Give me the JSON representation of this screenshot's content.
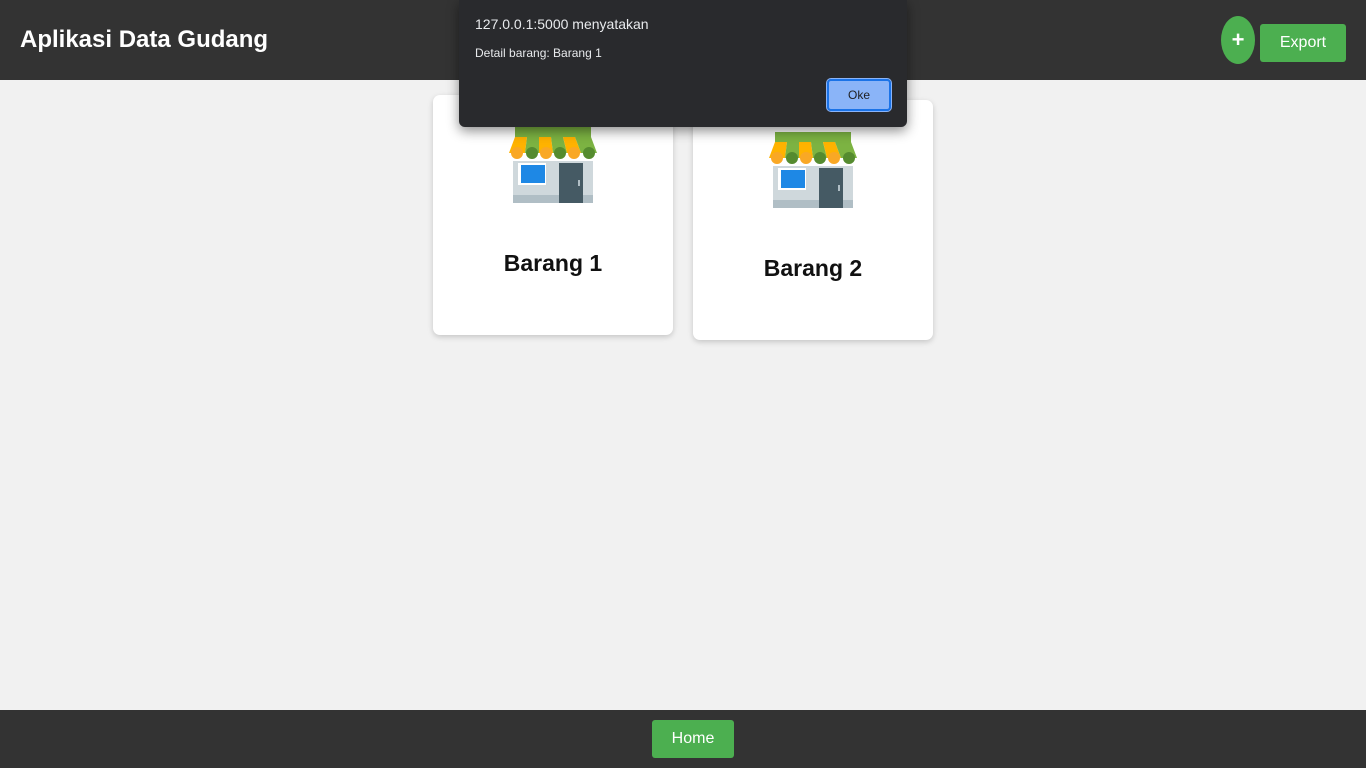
{
  "header": {
    "title": "Aplikasi Data Gudang",
    "add_label": "+",
    "export_label": "Export"
  },
  "cards": [
    {
      "title": "Barang 1",
      "icon": "store-icon"
    },
    {
      "title": "Barang 2",
      "icon": "store-icon"
    }
  ],
  "footer": {
    "home_label": "Home"
  },
  "dialog": {
    "origin": "127.0.0.1:5000 menyatakan",
    "message": "Detail barang: Barang 1",
    "ok_label": "Oke"
  },
  "colors": {
    "bar": "#333333",
    "accent": "#4caf50",
    "page_bg": "#f1f1f1",
    "dialog_bg": "#292a2d",
    "dialog_button": "#8ab4f8"
  }
}
